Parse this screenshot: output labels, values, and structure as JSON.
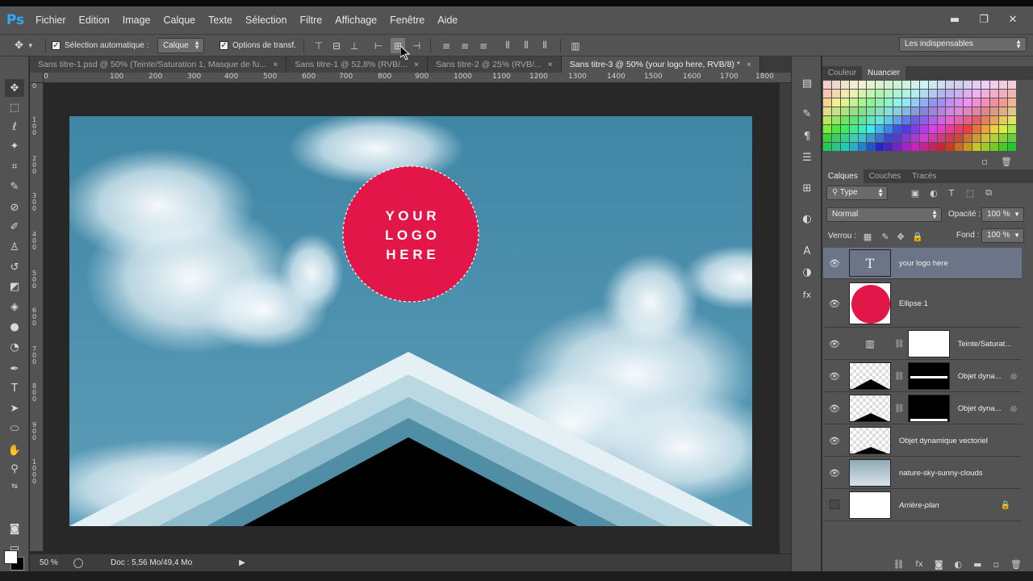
{
  "app": {
    "logo": "Ps"
  },
  "menu": [
    "Fichier",
    "Edition",
    "Image",
    "Calque",
    "Texte",
    "Sélection",
    "Filtre",
    "Affichage",
    "Fenêtre",
    "Aide"
  ],
  "window_controls": {
    "minimize": "▬",
    "restore": "❐",
    "close": "✕"
  },
  "options": {
    "auto_select_label": "Sélection automatique :",
    "auto_select_value": "Calque",
    "transform_label": "Options de transf.",
    "workspace": "Les indispensables"
  },
  "tabs": [
    {
      "label": "Sans titre-1.psd @ 50% (Teinte/Saturation 1, Masque de fu...",
      "close": "×"
    },
    {
      "label": "Sans titre-1 @ 52,8% (RVB/...",
      "close": "×"
    },
    {
      "label": "Sans titre-2 @ 25% (RVB/...",
      "close": "×"
    },
    {
      "label": "Sans titre-3 @ 50% (your logo here, RVB/8) *",
      "close": "×"
    }
  ],
  "ruler_h": [
    "0",
    "100",
    "200",
    "300",
    "400",
    "500",
    "600",
    "700",
    "800",
    "900",
    "1000",
    "1100",
    "1200",
    "1300",
    "1400",
    "1500",
    "1600",
    "1700",
    "1800"
  ],
  "ruler_v": [
    "0",
    "1 0 0",
    "2 0 0",
    "3 0 0",
    "4 0 0",
    "5 0 0",
    "6 0 0",
    "7 0 0",
    "8 0 0",
    "9 0 0",
    "1 0 0 0"
  ],
  "canvas": {
    "logo_lines": [
      "Y O U R",
      "L O G O",
      "H E R E"
    ],
    "logo_color": "#e3164a"
  },
  "status": {
    "zoom": "50 %",
    "doc": "Doc : 5,56 Mo/49,4 Mo"
  },
  "panels": {
    "top_tabs": [
      "Couleur",
      "Nuancier"
    ],
    "layer_tabs": [
      "Calques",
      "Couches",
      "Tracés"
    ],
    "filter": "Type",
    "blend_mode": "Normal",
    "opacity_label": "Opacité :",
    "opacity_value": "100 %",
    "lock_label": "Verrou :",
    "fill_label": "Fond :",
    "fill_value": "100 %"
  },
  "layers": [
    {
      "name": "your logo here"
    },
    {
      "name": "Ellipse 1"
    },
    {
      "name": "Teinte/Saturat..."
    },
    {
      "name": "Objet dyna..."
    },
    {
      "name": "Objet dyna..."
    },
    {
      "name": "Objet dynamique vectoriel"
    },
    {
      "name": "nature-sky-sunny-clouds"
    },
    {
      "name": "Arrière-plan"
    }
  ]
}
